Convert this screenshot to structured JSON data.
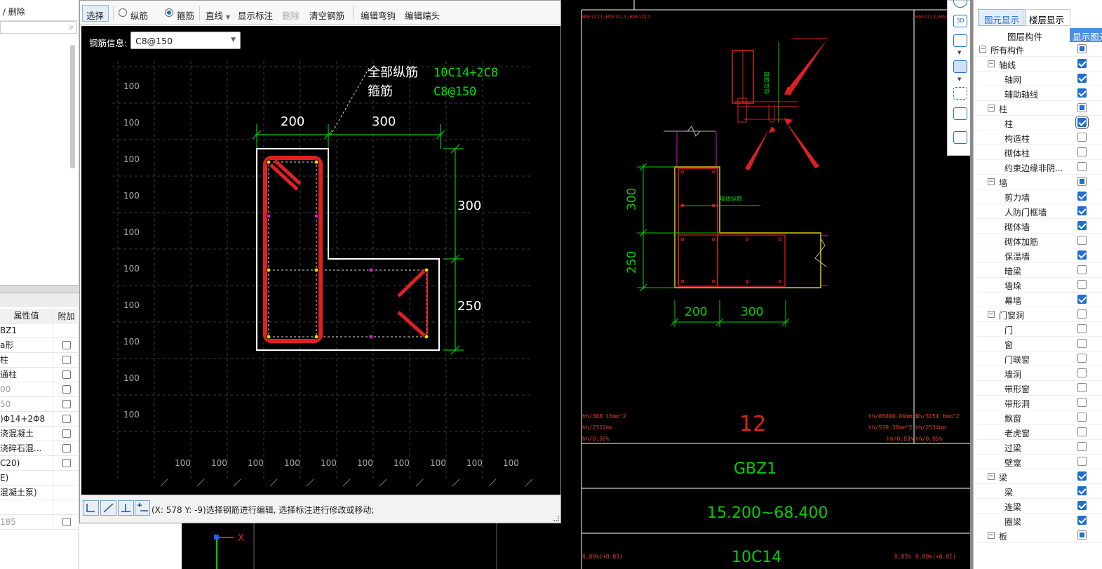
{
  "left_panel": {
    "toolbar_label": "删除",
    "prop_header": {
      "value_col": "属性值",
      "extra_col": "附加"
    },
    "props": [
      {
        "value": "BZ1",
        "check": false,
        "dim": false
      },
      {
        "value": "a形",
        "check": true,
        "dim": false
      },
      {
        "value": "柱",
        "check": true,
        "dim": false
      },
      {
        "value": "通柱",
        "check": true,
        "dim": false
      },
      {
        "value": "00",
        "check": true,
        "dim": true
      },
      {
        "value": "50",
        "check": true,
        "dim": true
      },
      {
        "value": ")Φ14+2Φ8",
        "check": true,
        "dim": false
      },
      {
        "value": "浇混凝土",
        "check": true,
        "dim": false
      },
      {
        "value": "浇碎石混...",
        "check": true,
        "dim": false
      },
      {
        "value": "C20)",
        "check": true,
        "dim": false
      },
      {
        "value": "E)",
        "check": false,
        "dim": false
      },
      {
        "value": "混凝土泵)",
        "check": false,
        "dim": false
      },
      {
        "value": "",
        "check": false,
        "dim": false
      },
      {
        "value": "185",
        "check": true,
        "dim": true
      }
    ]
  },
  "editor": {
    "toolbar": {
      "select": "选择",
      "longitudinal": "纵筋",
      "stirrup": "箍筋",
      "line": "直线",
      "show_dims": "显示标注",
      "delete": "删除",
      "clear": "清空钢筋",
      "edit_hook": "编辑弯钩",
      "edit_end": "编辑端头"
    },
    "rebar_info_label": "钢筋信息:",
    "rebar_info_value": "C8@150",
    "canvas": {
      "label_all_long": "全部纵筋",
      "value_all_long": "10C14+2C8",
      "label_stirrup": "箍筋",
      "value_stirrup": "C8@150",
      "dim_top_left": "200",
      "dim_top_right": "300",
      "dim_right_top": "300",
      "dim_right_bottom": "250",
      "grid_label": "100"
    },
    "status_text": "(X: 578 Y: -9)选择钢筋进行编辑, 选择标注进行修改或移动;"
  },
  "cad": {
    "dim_300": "300",
    "dim_250": "250",
    "dim_200": "200",
    "dim_300b": "300",
    "table_number": "12",
    "table_name": "GBZ1",
    "table_elev": "15.200~68.400",
    "table_rebar": "10C14",
    "table_rebar_label": "纵筋",
    "axis_x": "X"
  },
  "right_panel": {
    "tab_active": "图元显示",
    "tab_other": "楼层显示",
    "col_component": "图层构件",
    "col_show": "显示图元",
    "layers": [
      {
        "label": "所有构件",
        "level": 0,
        "expand": true,
        "state": "part"
      },
      {
        "label": "轴线",
        "level": 1,
        "expand": true,
        "state": "on"
      },
      {
        "label": "轴网",
        "level": 2,
        "expand": false,
        "state": "on"
      },
      {
        "label": "辅助轴线",
        "level": 2,
        "expand": false,
        "state": "on"
      },
      {
        "label": "柱",
        "level": 1,
        "expand": true,
        "state": "part"
      },
      {
        "label": "柱",
        "level": 2,
        "expand": false,
        "state": "on",
        "sel": true
      },
      {
        "label": "构造柱",
        "level": 2,
        "expand": false,
        "state": "off"
      },
      {
        "label": "砌体柱",
        "level": 2,
        "expand": false,
        "state": "off"
      },
      {
        "label": "约束边缘非阴...",
        "level": 2,
        "expand": false,
        "state": "off"
      },
      {
        "label": "墙",
        "level": 1,
        "expand": true,
        "state": "part"
      },
      {
        "label": "剪力墙",
        "level": 2,
        "expand": false,
        "state": "on"
      },
      {
        "label": "人防门框墙",
        "level": 2,
        "expand": false,
        "state": "on"
      },
      {
        "label": "砌体墙",
        "level": 2,
        "expand": false,
        "state": "on"
      },
      {
        "label": "砌体加筋",
        "level": 2,
        "expand": false,
        "state": "off"
      },
      {
        "label": "保温墙",
        "level": 2,
        "expand": false,
        "state": "on"
      },
      {
        "label": "暗梁",
        "level": 2,
        "expand": false,
        "state": "off"
      },
      {
        "label": "墙垛",
        "level": 2,
        "expand": false,
        "state": "off"
      },
      {
        "label": "幕墙",
        "level": 2,
        "expand": false,
        "state": "on"
      },
      {
        "label": "门窗洞",
        "level": 1,
        "expand": true,
        "state": "off"
      },
      {
        "label": "门",
        "level": 2,
        "expand": false,
        "state": "off"
      },
      {
        "label": "窗",
        "level": 2,
        "expand": false,
        "state": "off"
      },
      {
        "label": "门联窗",
        "level": 2,
        "expand": false,
        "state": "off"
      },
      {
        "label": "墙洞",
        "level": 2,
        "expand": false,
        "state": "off"
      },
      {
        "label": "带形窗",
        "level": 2,
        "expand": false,
        "state": "off"
      },
      {
        "label": "带形洞",
        "level": 2,
        "expand": false,
        "state": "off"
      },
      {
        "label": "飘窗",
        "level": 2,
        "expand": false,
        "state": "off"
      },
      {
        "label": "老虎窗",
        "level": 2,
        "expand": false,
        "state": "off"
      },
      {
        "label": "过梁",
        "level": 2,
        "expand": false,
        "state": "off"
      },
      {
        "label": "壁龛",
        "level": 2,
        "expand": false,
        "state": "off"
      },
      {
        "label": "梁",
        "level": 1,
        "expand": true,
        "state": "on"
      },
      {
        "label": "梁",
        "level": 2,
        "expand": false,
        "state": "on"
      },
      {
        "label": "连梁",
        "level": 2,
        "expand": false,
        "state": "on"
      },
      {
        "label": "圈梁",
        "level": 2,
        "expand": false,
        "state": "on"
      },
      {
        "label": "板",
        "level": 1,
        "expand": true,
        "state": "part"
      }
    ]
  }
}
